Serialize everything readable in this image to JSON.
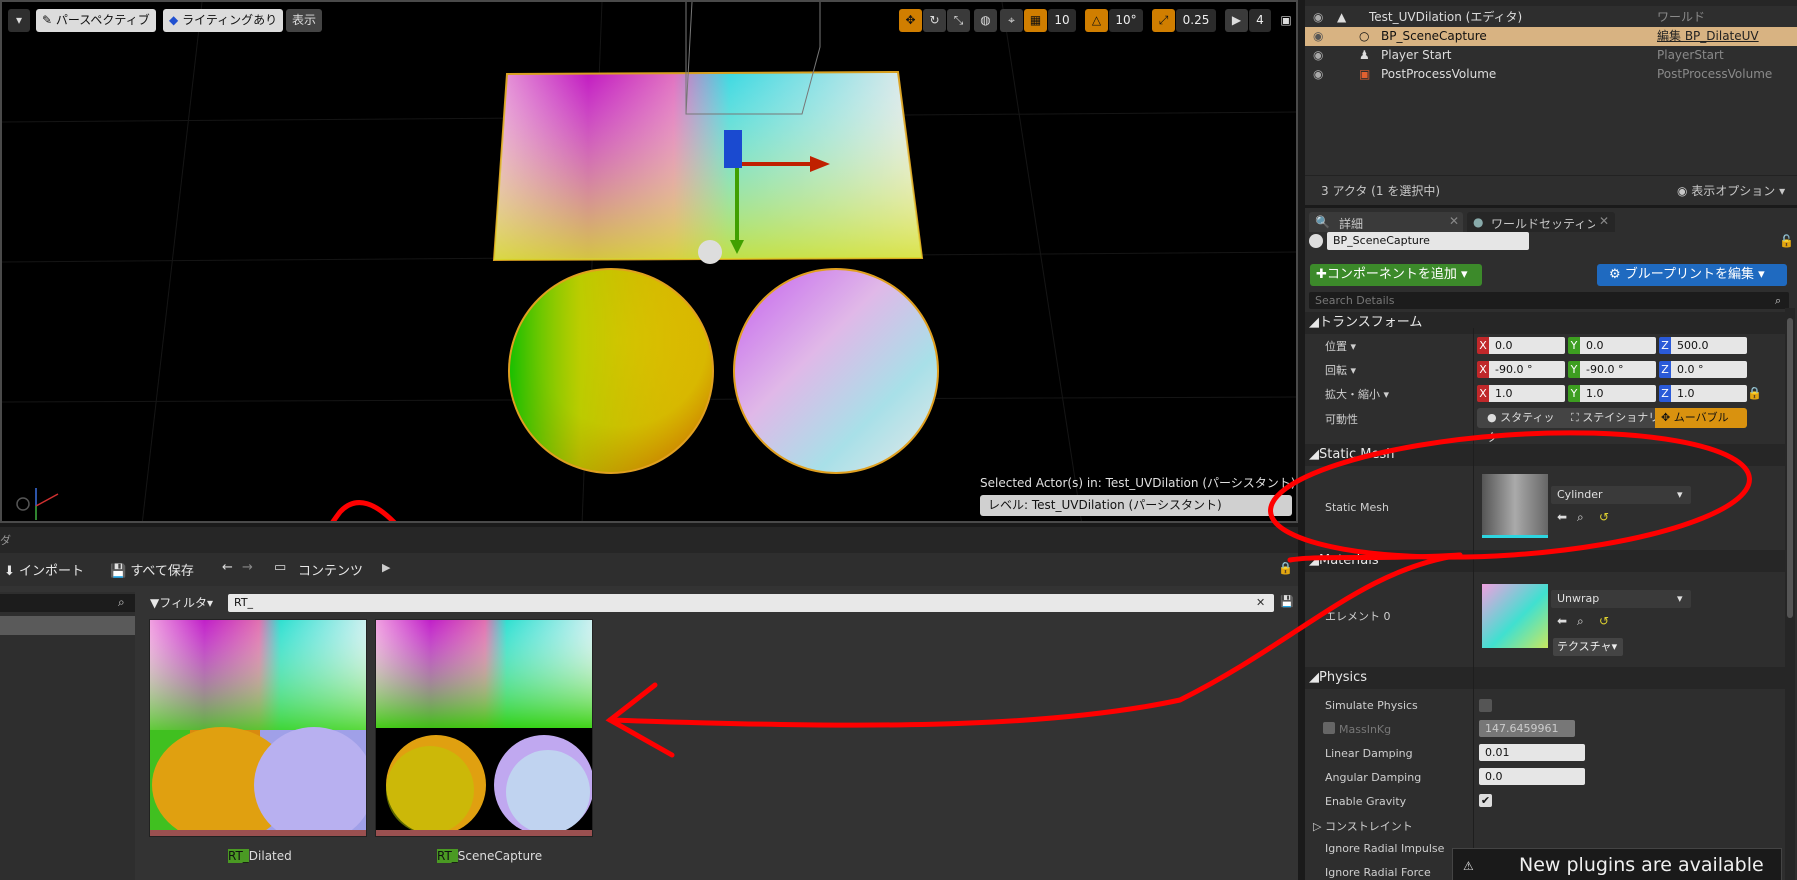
{
  "viewport": {
    "perspective_label": "パースペクティブ",
    "lighting_label": "ライティングあり",
    "show_label": "表示",
    "grid_snap": "10",
    "rot_snap": "10°",
    "scale_snap": "0.25",
    "cam_speed": "4",
    "selected_text": "Selected Actor(s) in:  Test_UVDilation (パーシスタント)",
    "level_text": "レベル:  Test_UVDilation (パーシスタント)"
  },
  "outliner": {
    "rows": [
      {
        "name": "Test_UVDilation (エディタ)",
        "type": "ワールド"
      },
      {
        "name": "BP_SceneCapture",
        "type": "編集 BP_DilateUV"
      },
      {
        "name": "Player Start",
        "type": "PlayerStart"
      },
      {
        "name": "PostProcessVolume",
        "type": "PostProcessVolume"
      }
    ],
    "footer": "3 アクタ (1 を選択中)",
    "view_options": "表示オプション"
  },
  "details": {
    "tabs": [
      "詳細",
      "ワールドセッティング"
    ],
    "actor_name": "BP_SceneCapture",
    "add_component": "コンポーネントを追加",
    "edit_blueprint": "ブループリントを編集",
    "search_placeholder": "Search Details",
    "transform": {
      "title": "トランスフォーム",
      "location_label": "位置",
      "rotation_label": "回転",
      "scale_label": "拡大・縮小",
      "mobility_label": "可動性",
      "location": [
        "0.0",
        "0.0",
        "500.0"
      ],
      "rotation": [
        "-90.0 °",
        "-90.0 °",
        "0.0 °"
      ],
      "scale": [
        "1.0",
        "1.0",
        "1.0"
      ],
      "mobility": [
        "スタティック",
        "ステイショナリ",
        "ムーバブル"
      ]
    },
    "static_mesh": {
      "title": "Static Mesh",
      "label": "Static Mesh",
      "value": "Cylinder"
    },
    "materials": {
      "title": "Materials",
      "label": "エレメント 0",
      "value": "Unwrap",
      "texture_btn": "テクスチャ"
    },
    "physics": {
      "title": "Physics",
      "simulate": "Simulate Physics",
      "mass": "MassInKg",
      "mass_value": "147.6459961",
      "linear": "Linear Damping",
      "linear_value": "0.01",
      "angular": "Angular Damping",
      "angular_value": "0.0",
      "gravity": "Enable Gravity",
      "constraints": "コンストレイント",
      "ignore_impulse": "Ignore Radial Impulse",
      "ignore_force": "Ignore Radial Force"
    }
  },
  "content_browser": {
    "import": "インポート",
    "save_all": "すべて保存",
    "path": "コンテンツ",
    "filter": "フィルタ",
    "search_value": "RT_",
    "assets": [
      {
        "prefix": "RT_",
        "rest": "Dilated"
      },
      {
        "prefix": "RT_",
        "rest": "SceneCapture"
      }
    ]
  },
  "notification": "New plugins are available"
}
